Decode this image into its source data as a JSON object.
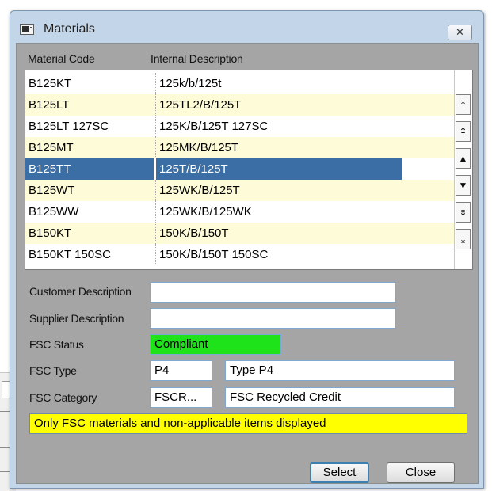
{
  "window": {
    "title": "Materials",
    "close_glyph": "✕"
  },
  "list": {
    "columns": [
      "Material Code",
      "Internal Description"
    ],
    "rows": [
      {
        "code": "B125KT",
        "description": "125k/b/125t"
      },
      {
        "code": "B125LT",
        "description": "125TL2/B/125T"
      },
      {
        "code": "B125LT 127SC",
        "description": "125K/B/125T 127SC"
      },
      {
        "code": "B125MT",
        "description": "125MK/B/125T"
      },
      {
        "code": "B125TT",
        "description": "125T/B/125T"
      },
      {
        "code": "B125WT",
        "description": "125WK/B/125T"
      },
      {
        "code": "B125WW",
        "description": "125WK/B/125WK"
      },
      {
        "code": "B150KT",
        "description": "150K/B/150T"
      },
      {
        "code": "B150KT 150SC",
        "description": "150K/B/150T 150SC"
      }
    ],
    "selected_index": 4,
    "scroll_buttons": [
      {
        "name": "scroll-top-icon",
        "glyph": "⤒"
      },
      {
        "name": "page-up-icon",
        "glyph": "⇞"
      },
      {
        "name": "scroll-up-icon",
        "glyph": "▲"
      },
      {
        "name": "scroll-down-icon",
        "glyph": "▼"
      },
      {
        "name": "page-down-icon",
        "glyph": "⇟"
      },
      {
        "name": "scroll-bottom-icon",
        "glyph": "⤓"
      }
    ]
  },
  "form": {
    "customer_description_label": "Customer Description",
    "customer_description_value": "",
    "supplier_description_label": "Supplier Description",
    "supplier_description_value": "",
    "fsc_status_label": "FSC Status",
    "fsc_status_value": "Compliant",
    "fsc_status_color": "#1ee21a",
    "fsc_type_label": "FSC Type",
    "fsc_type_code": "P4",
    "fsc_type_name": "Type P4",
    "fsc_category_label": "FSC Category",
    "fsc_category_code": "FSCR...",
    "fsc_category_name": "FSC Recycled Credit"
  },
  "notice": {
    "text": "Only FSC materials and non-applicable items displayed",
    "color": "#ffff00"
  },
  "buttons": {
    "select": "Select",
    "close": "Close"
  },
  "colors": {
    "selection": "#3a6ea5",
    "alt_row": "#fefbd8",
    "dialog_bg": "#a5a5a5",
    "frame": "#c3d6e9"
  }
}
